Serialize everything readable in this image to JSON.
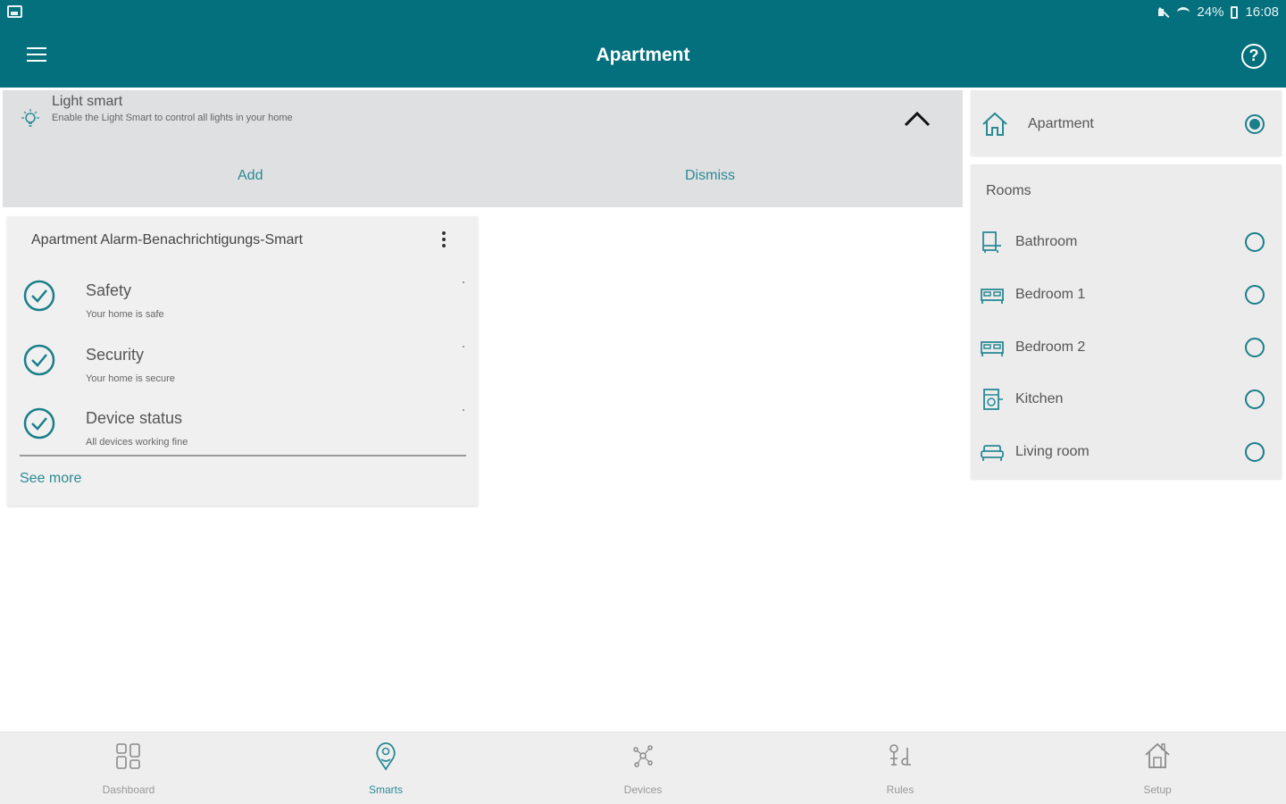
{
  "status_bar": {
    "battery": "24%",
    "time": "16:08"
  },
  "toolbar": {
    "title": "Apartment"
  },
  "banner": {
    "title": "Light smart",
    "description": "Enable the Light Smart to control all lights in your home",
    "add_label": "Add",
    "dismiss_label": "Dismiss"
  },
  "alarm_card": {
    "title": "Apartment Alarm-Benachrichtigungs-Smart",
    "items": [
      {
        "title": "Safety",
        "subtitle": "Your home is safe"
      },
      {
        "title": "Security",
        "subtitle": "Your home is secure"
      },
      {
        "title": "Device status",
        "subtitle": "All devices working fine"
      }
    ],
    "see_more_label": "See more"
  },
  "home_selector": {
    "label": "Apartment",
    "selected": true
  },
  "rooms": {
    "title": "Rooms",
    "items": [
      {
        "label": "Bathroom",
        "icon": "bathroom-icon",
        "selected": false
      },
      {
        "label": "Bedroom 1",
        "icon": "bed-icon",
        "selected": false
      },
      {
        "label": "Bedroom 2",
        "icon": "bed-icon",
        "selected": false
      },
      {
        "label": "Kitchen",
        "icon": "kitchen-icon",
        "selected": false
      },
      {
        "label": "Living room",
        "icon": "sofa-icon",
        "selected": false
      }
    ]
  },
  "bottom_nav": {
    "items": [
      {
        "label": "Dashboard",
        "icon": "dashboard-icon",
        "active": false
      },
      {
        "label": "Smarts",
        "icon": "smarts-icon",
        "active": true
      },
      {
        "label": "Devices",
        "icon": "devices-icon",
        "active": false
      },
      {
        "label": "Rules",
        "icon": "rules-icon",
        "active": false
      },
      {
        "label": "Setup",
        "icon": "setup-icon",
        "active": false
      }
    ]
  },
  "colors": {
    "primary": "#04707d",
    "accent": "#2a8a95",
    "banner_bg": "#dfe0e1"
  }
}
